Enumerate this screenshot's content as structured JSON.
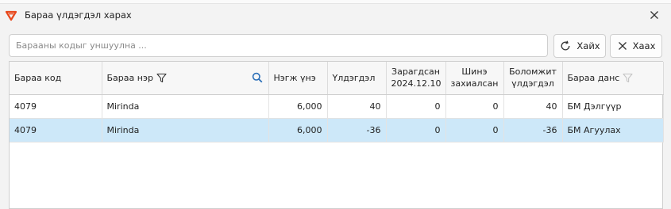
{
  "window": {
    "title": "Бараа үлдэгдэл харах",
    "colors": {
      "accent": "#e8481c",
      "selected_row": "#cde8f9",
      "search_icon": "#2b6fb8"
    }
  },
  "search": {
    "placeholder": "Барааны кодыг уншуулна ..."
  },
  "toolbar": {
    "search_label": "Хайх",
    "close_label": "Хаах"
  },
  "table": {
    "headers": {
      "code": "Бараа код",
      "name": "Бараа нэр",
      "unit_price": "Нэгж үнэ",
      "balance": "Үлдэгдэл",
      "spent_line1": "Зарагдсан",
      "spent_line2": "2024.12.10",
      "new_order_line1": "Шинэ",
      "new_order_line2": "захиалсан",
      "available_line1": "Боломжит",
      "available_line2": "үлдэгдэл",
      "account": "Бараа данс"
    },
    "rows": [
      {
        "code": "4079",
        "name": "Mirinda",
        "unit_price": "6,000",
        "balance": "40",
        "spent": "0",
        "new_order": "0",
        "available": "40",
        "account": "БМ Дэлгүүр"
      },
      {
        "code": "4079",
        "name": "Mirinda",
        "unit_price": "6,000",
        "balance": "-36",
        "spent": "0",
        "new_order": "0",
        "available": "-36",
        "account": "БМ Агуулах"
      }
    ]
  }
}
